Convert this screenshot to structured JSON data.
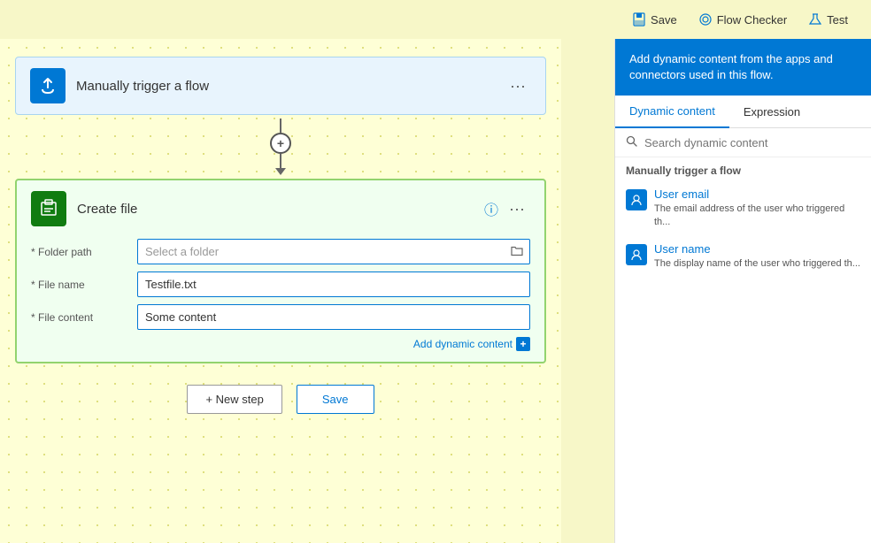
{
  "toolbar": {
    "save_label": "Save",
    "flow_checker_label": "Flow Checker",
    "test_label": "Test"
  },
  "trigger": {
    "title": "Manually trigger a flow"
  },
  "action": {
    "title": "Create file",
    "fields": {
      "folder_path_label": "* Folder path",
      "folder_path_placeholder": "Select a folder",
      "file_name_label": "* File name",
      "file_name_value": "Testfile.txt",
      "file_content_label": "* File content",
      "file_content_value": "Some content"
    },
    "add_dynamic_content": "Add dynamic content"
  },
  "bottom": {
    "new_step_label": "+ New step",
    "save_label": "Save"
  },
  "right_panel": {
    "header": "Add dynamic content from the apps and connectors used in this flow.",
    "tab_dynamic": "Dynamic content",
    "tab_expression": "Expression",
    "search_placeholder": "Search dynamic content",
    "section_title": "Manually trigger a flow",
    "items": [
      {
        "title": "User email",
        "desc": "The email address of the user who triggered th..."
      },
      {
        "title": "User name",
        "desc": "The display name of the user who triggered th..."
      }
    ]
  },
  "icons": {
    "trigger_icon": "↑",
    "action_icon": "⬜",
    "info_icon": "ⓘ",
    "menu_icon": "···",
    "folder_icon": "📁",
    "search_icon": "🔍",
    "plus_icon": "+",
    "user_icon": "👤",
    "save_icon": "💾",
    "flow_checker_icon": "◎",
    "test_icon": "⚗"
  }
}
